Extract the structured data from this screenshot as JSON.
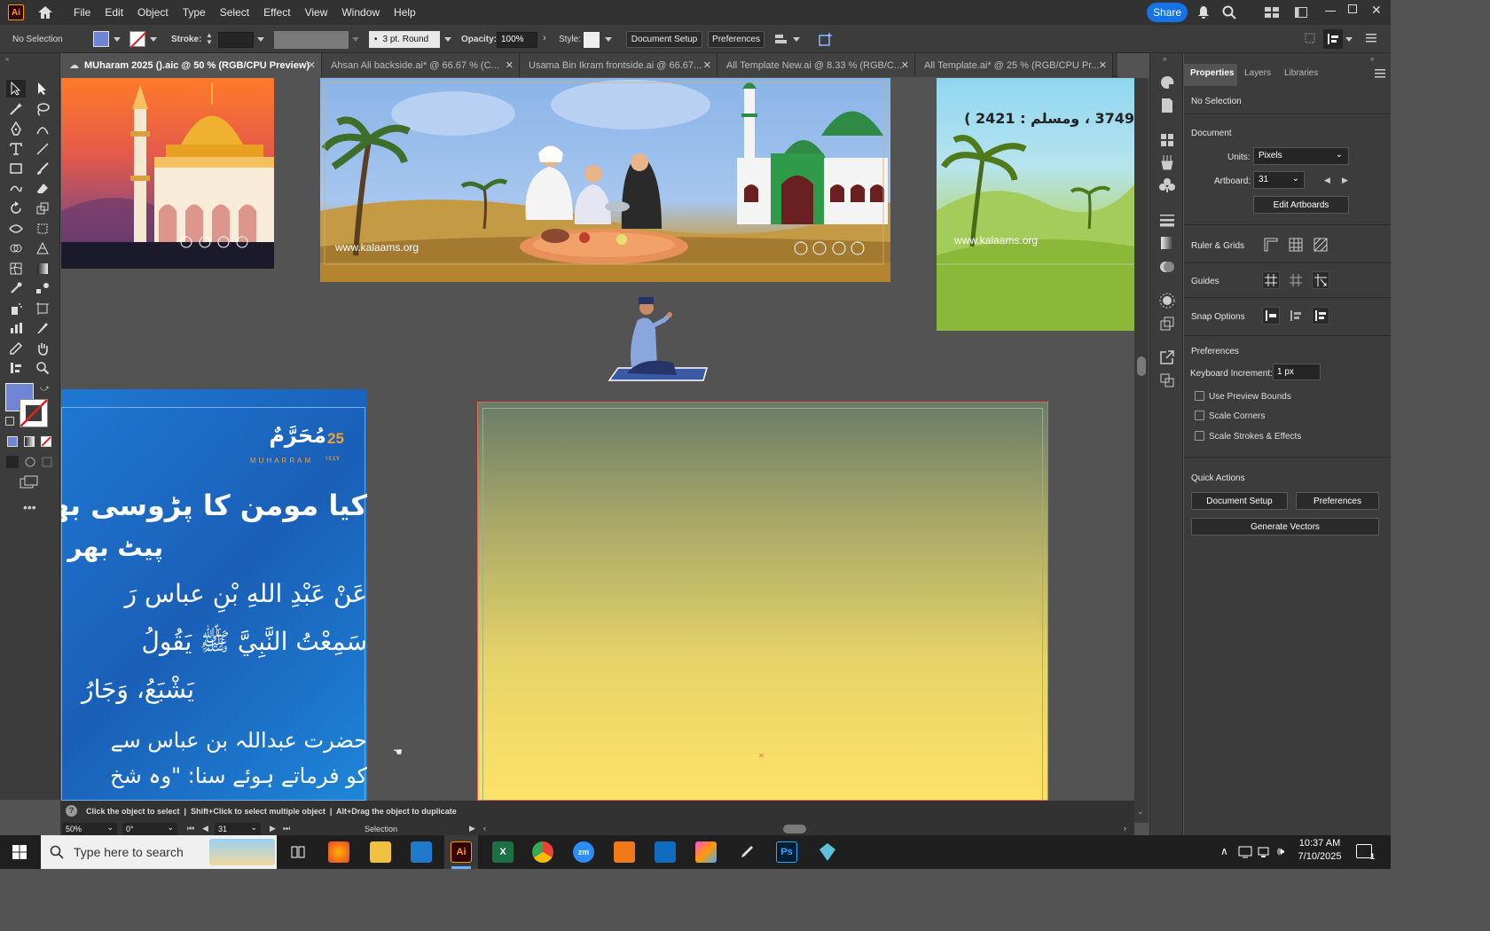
{
  "app": {
    "logo": "Ai",
    "menus": [
      "File",
      "Edit",
      "Object",
      "Type",
      "Select",
      "Effect",
      "View",
      "Window",
      "Help"
    ],
    "share_label": "Share"
  },
  "control_bar": {
    "selection_label": "No Selection",
    "stroke_label": "Stroke:",
    "brush_value": "3 pt. Round",
    "opacity_label": "Opacity:",
    "opacity_value": "100%",
    "style_label": "Style:",
    "document_setup": "Document Setup",
    "preferences": "Preferences",
    "fill_color": "#6f86d6"
  },
  "tabs": [
    {
      "label": "MUharam 2025 ().aic @ 50 % (RGB/CPU Preview)",
      "active": true
    },
    {
      "label": "Ahsan Ali backside.ai* @ 66.67 % (C...",
      "active": false
    },
    {
      "label": "Usama Bin Ikram frontside.ai @ 66.67...",
      "active": false
    },
    {
      "label": "All Template New.ai @ 8.33 % (RGB/C...",
      "active": false
    },
    {
      "label": "All Template.ai* @ 25 % (RGB/CPU Pr...",
      "active": false
    }
  ],
  "artwork": {
    "banner_url": "www.kalaams.org",
    "right_url": "www.kalaams.org",
    "right_text": "3749 ، ومسلم : 2421 )",
    "muharram_num": "25",
    "muharram_arabic": "مُحَرَّمٌ",
    "muharram_latin": "MUHARRAM",
    "muharram_year": "١٤٤٧",
    "urdu_line1": "کیا مومن کا پڑوسی بھ",
    "urdu_line2": "پیٹ بھر",
    "arabic_line1": "عَنْ عَبْدِ اللهِ بْنِ عباس رَ",
    "arabic_line2": "سَمِعْتُ النَّبِيَّ ﷺ يَقُولُ",
    "arabic_line3": "يَشْبَعُ، وَجَارُ",
    "urdu_line3": "حضرت عبداللہ بن عباس سے",
    "urdu_line4": "کو فرماتے ہوئے سنا: \"وہ شخ"
  },
  "properties": {
    "tabs": [
      "Properties",
      "Layers",
      "Libraries"
    ],
    "no_selection": "No Selection",
    "document_heading": "Document",
    "units_label": "Units:",
    "units_value": "Pixels",
    "artboard_label": "Artboard:",
    "artboard_value": "31",
    "edit_artboards": "Edit Artboards",
    "ruler_grids": "Ruler & Grids",
    "guides": "Guides",
    "snap_options": "Snap Options",
    "preferences_heading": "Preferences",
    "keyboard_increment_label": "Keyboard Increment:",
    "keyboard_increment_value": "1 px",
    "use_preview_bounds": "Use Preview Bounds",
    "scale_corners": "Scale Corners",
    "scale_strokes": "Scale Strokes & Effects",
    "quick_actions": "Quick Actions",
    "document_setup": "Document Setup",
    "preferences_btn": "Preferences",
    "generate_vectors": "Generate Vectors"
  },
  "status": {
    "hint_click": "Click the object to select",
    "hint_shift": "Shift+Click to select multiple object",
    "hint_alt": "Alt+Drag the object to duplicate",
    "zoom": "50%",
    "rotation": "0°",
    "artboard": "31",
    "mode": "Selection"
  },
  "taskbar": {
    "search_placeholder": "Type here to search",
    "time": "10:37 AM",
    "date": "7/10/2025",
    "notification_count": "1"
  }
}
